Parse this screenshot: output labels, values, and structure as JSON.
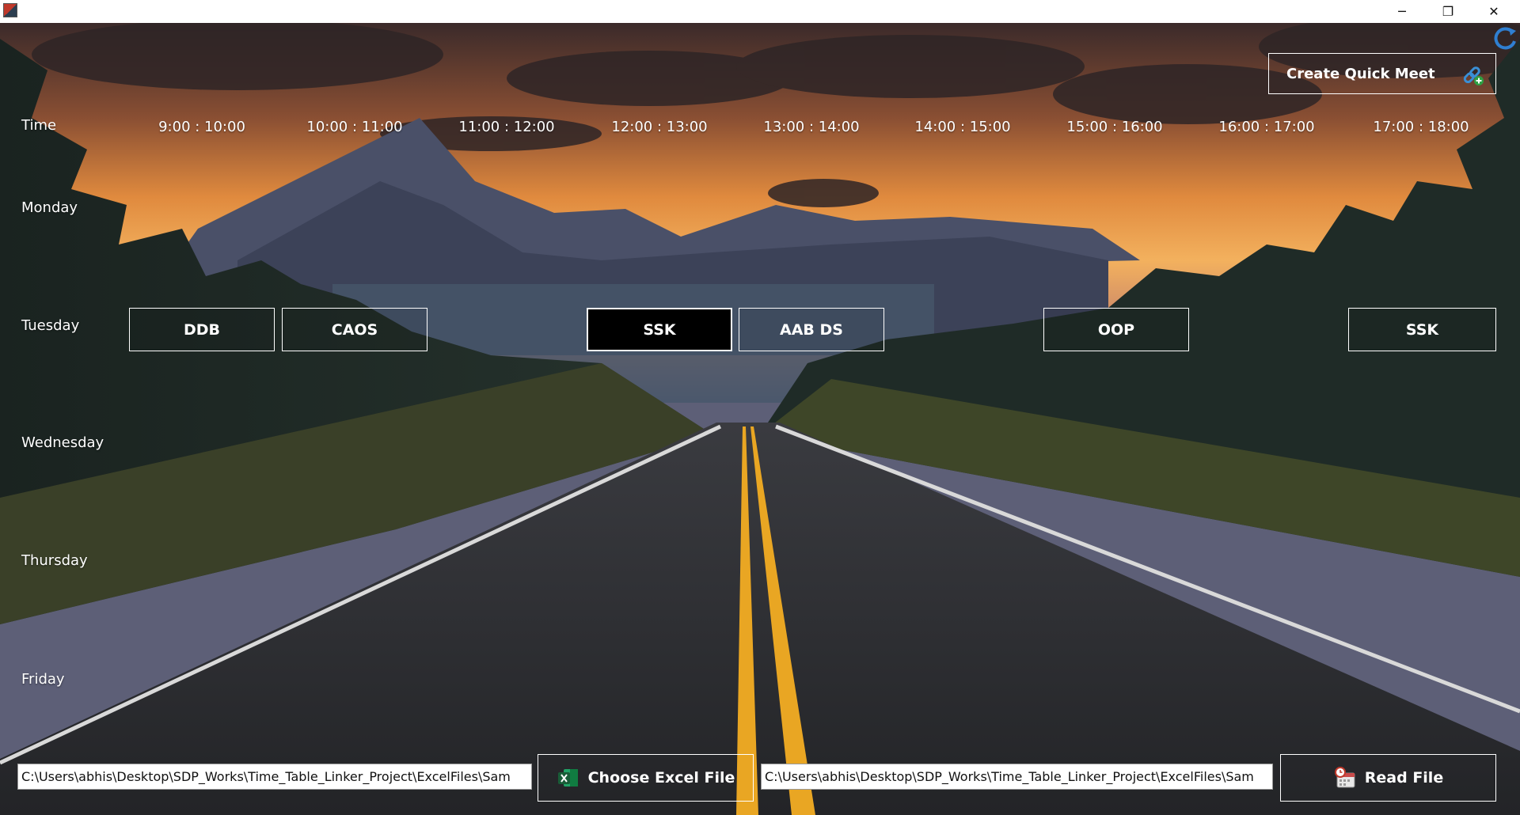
{
  "window": {
    "minimize_glyph": "─",
    "maximize_glyph": "❐",
    "close_glyph": "✕"
  },
  "header": {
    "time_label": "Time",
    "slots": [
      "9:00 : 10:00",
      "10:00 : 11:00",
      "11:00 : 12:00",
      "12:00 : 13:00",
      "13:00 : 14:00",
      "14:00 : 15:00",
      "15:00 : 16:00",
      "16:00 : 17:00",
      "17:00 : 18:00"
    ]
  },
  "days": [
    "Monday",
    "Tuesday",
    "Wednesday",
    "Thursday",
    "Friday"
  ],
  "tuesday_classes": [
    {
      "label": "DDB",
      "slot": "9:00 : 10:00",
      "selected": false
    },
    {
      "label": "CAOS",
      "slot": "10:00 : 11:00",
      "selected": false
    },
    {
      "label": "SSK",
      "slot": "12:00 : 13:00",
      "selected": true
    },
    {
      "label": "AAB DS",
      "slot": "13:00 : 14:00",
      "selected": false
    },
    {
      "label": "OOP",
      "slot": "15:00 : 16:00",
      "selected": false
    },
    {
      "label": "SSK",
      "slot": "17:00 : 18:00",
      "selected": false
    }
  ],
  "quick_meet": {
    "label": "Create Quick Meet",
    "icon": "link-plus-icon"
  },
  "footer": {
    "excel_path": "C:\\Users\\abhis\\Desktop\\SDP_Works\\Time_Table_Linker_Project\\ExcelFiles\\Sam",
    "choose_label": "Choose Excel File",
    "choose_icon": "excel-icon",
    "read_path": "C:\\Users\\abhis\\Desktop\\SDP_Works\\Time_Table_Linker_Project\\ExcelFiles\\Sam",
    "read_label": "Read File",
    "read_icon": "calendar-clock-icon"
  },
  "colors": {
    "accent_white": "#ffffff",
    "selected_bg": "#000000",
    "excel_green": "#1d6f42"
  }
}
